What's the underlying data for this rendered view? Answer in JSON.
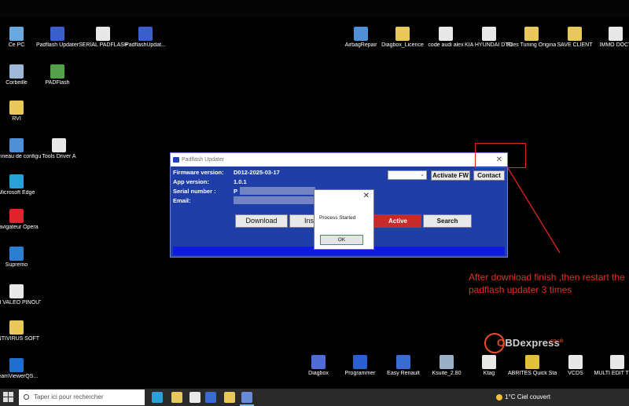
{
  "desktop_icons": [
    {
      "id": "ce-pc",
      "label": "Ce PC",
      "color": "#6aa8e0"
    },
    {
      "id": "padflash-updater",
      "label": "Padflash Updater",
      "color": "#3a5fcd"
    },
    {
      "id": "serial-padflash",
      "label": "SERIAL PADFLASH",
      "color": "#e8e8e8"
    },
    {
      "id": "padflash-update-zip",
      "label": "PadflashUpdat...",
      "color": "#3a5fcd"
    },
    {
      "id": "corbeille",
      "label": "Corbeille",
      "color": "#9fb7d9"
    },
    {
      "id": "padflash",
      "label": "PADFlash",
      "color": "#55a04a"
    },
    {
      "id": "rvi",
      "label": "RVI",
      "color": "#e8c85a"
    },
    {
      "id": "panneau-config",
      "label": "Panneau de configuration",
      "color": "#4e8fd6"
    },
    {
      "id": "tools-driver",
      "label": "Tools Driver A",
      "color": "#e8e8e8"
    },
    {
      "id": "microsoft-edge",
      "label": "Microsoft Edge",
      "color": "#2aa0d8"
    },
    {
      "id": "navigateur-opera",
      "label": "Navigateur Opera",
      "color": "#e0242b"
    },
    {
      "id": "supremo",
      "label": "Supremo",
      "color": "#2a7fd0"
    },
    {
      "id": "bsi-valeo",
      "label": "BSI VALEO PINOUT",
      "color": "#e8e8e8"
    },
    {
      "id": "antivirus-soft",
      "label": "ANTIVIRUS SOFT",
      "color": "#e8c85a"
    },
    {
      "id": "teamviewer",
      "label": "TeamViewerQS...",
      "color": "#1f6fd0"
    },
    {
      "id": "airbag-repair",
      "label": "AirbagRepair",
      "color": "#4e8fd6"
    },
    {
      "id": "diagbox-licence",
      "label": "Diagbox_Licence",
      "color": "#e8c85a"
    },
    {
      "id": "code-audi-alex",
      "label": "code audi alex",
      "color": "#e8e8e8"
    },
    {
      "id": "kia-hyundai",
      "label": "KIA HYUNDAI DTC EDITOR",
      "color": "#e8e8e8"
    },
    {
      "id": "files-tuning",
      "label": "Files Tuning Original Stage...",
      "color": "#e8c85a"
    },
    {
      "id": "save-client",
      "label": "SAVE CLIENT",
      "color": "#e8c85a"
    },
    {
      "id": "immo-doct",
      "label": "IMMO DOCT",
      "color": "#e8e8e8"
    },
    {
      "id": "diagbox",
      "label": "Diagbox",
      "color": "#4e6bd6"
    },
    {
      "id": "programmer",
      "label": "Programmer",
      "color": "#2a5fd0"
    },
    {
      "id": "easy-renault",
      "label": "Easy Renault",
      "color": "#3a6bd0"
    },
    {
      "id": "ksuite",
      "label": "Ksuite_2.80",
      "color": "#9ab0c8"
    },
    {
      "id": "ktag",
      "label": "Ktag",
      "color": "#e8e8e8"
    },
    {
      "id": "abrites",
      "label": "ABRITES Quick Start",
      "color": "#e0c040"
    },
    {
      "id": "vcds",
      "label": "VCDS",
      "color": "#e8e8e8"
    },
    {
      "id": "multi-edit",
      "label": "MULTI EDIT TOOL",
      "color": "#e8e8e8"
    }
  ],
  "app": {
    "title": "Padflash Updater",
    "close_glyph": "✕",
    "fields": {
      "firmware_label": "Firmware version:",
      "firmware_value": "D012-2025-03-17",
      "app_label": "App version:",
      "app_value": "1.0.1",
      "serial_label": "Serial number :",
      "serial_value": "P",
      "email_label": "Email:"
    },
    "combo_arrow": "⌄",
    "buttons": {
      "activate_fw": "Activate FW",
      "contact": "Contact",
      "download": "Download",
      "install": "Inst",
      "active": "Active",
      "search": "Search"
    },
    "accent_blue": "#1f3ea8",
    "active_red": "#c62b2b"
  },
  "dialog": {
    "message": "Process Started",
    "ok": "OK",
    "close_glyph": "✕"
  },
  "annotation": {
    "text": "After download finish ,then restart the padflash updater 3 times",
    "color": "#e8301f"
  },
  "watermark": {
    "brand_pre": "",
    "brand_o": "O",
    "brand_rest": "BDexpress",
    "domain": ".co.uk"
  },
  "taskbar": {
    "search_placeholder": "Taper ici pour rechercher",
    "weather": "1°C Ciel couvert"
  }
}
